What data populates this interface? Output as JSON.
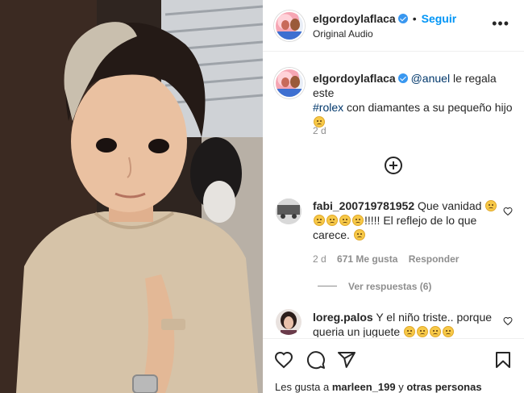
{
  "header": {
    "username": "elgordoylaflaca",
    "separator": "•",
    "follow_label": "Seguir",
    "audio": "Original Audio",
    "more_icon": "more-icon"
  },
  "caption": {
    "username": "elgordoylaflaca",
    "mention": "@anuel",
    "text_1": " le regala este",
    "hashtag": "#rolex",
    "text_2": " con diamantes a su pequeño hijo",
    "time": "2 d"
  },
  "load_more_icon": "plus-circle-icon",
  "comments": [
    {
      "username": "fabi_200719781952",
      "text_1": " Que vanidad ",
      "text_2": "!!!!! El reflejo de lo que",
      "text_3": "carece. ",
      "time": "2 d",
      "likes": "671 Me gusta",
      "reply": "Responder",
      "view_replies": "Ver respuestas (6)"
    },
    {
      "username": "loreg.palos",
      "text_1": " Y el niño triste.. porque",
      "text_2": "queria un juguete "
    }
  ],
  "likes_line": {
    "prefix": "Les gusta a ",
    "user": "marleen_199",
    "middle": " y ",
    "others": "otras personas"
  },
  "colors": {
    "accent": "#0095f6",
    "text": "#262626",
    "muted": "#8e8e8e",
    "verified": "#3897f0"
  }
}
